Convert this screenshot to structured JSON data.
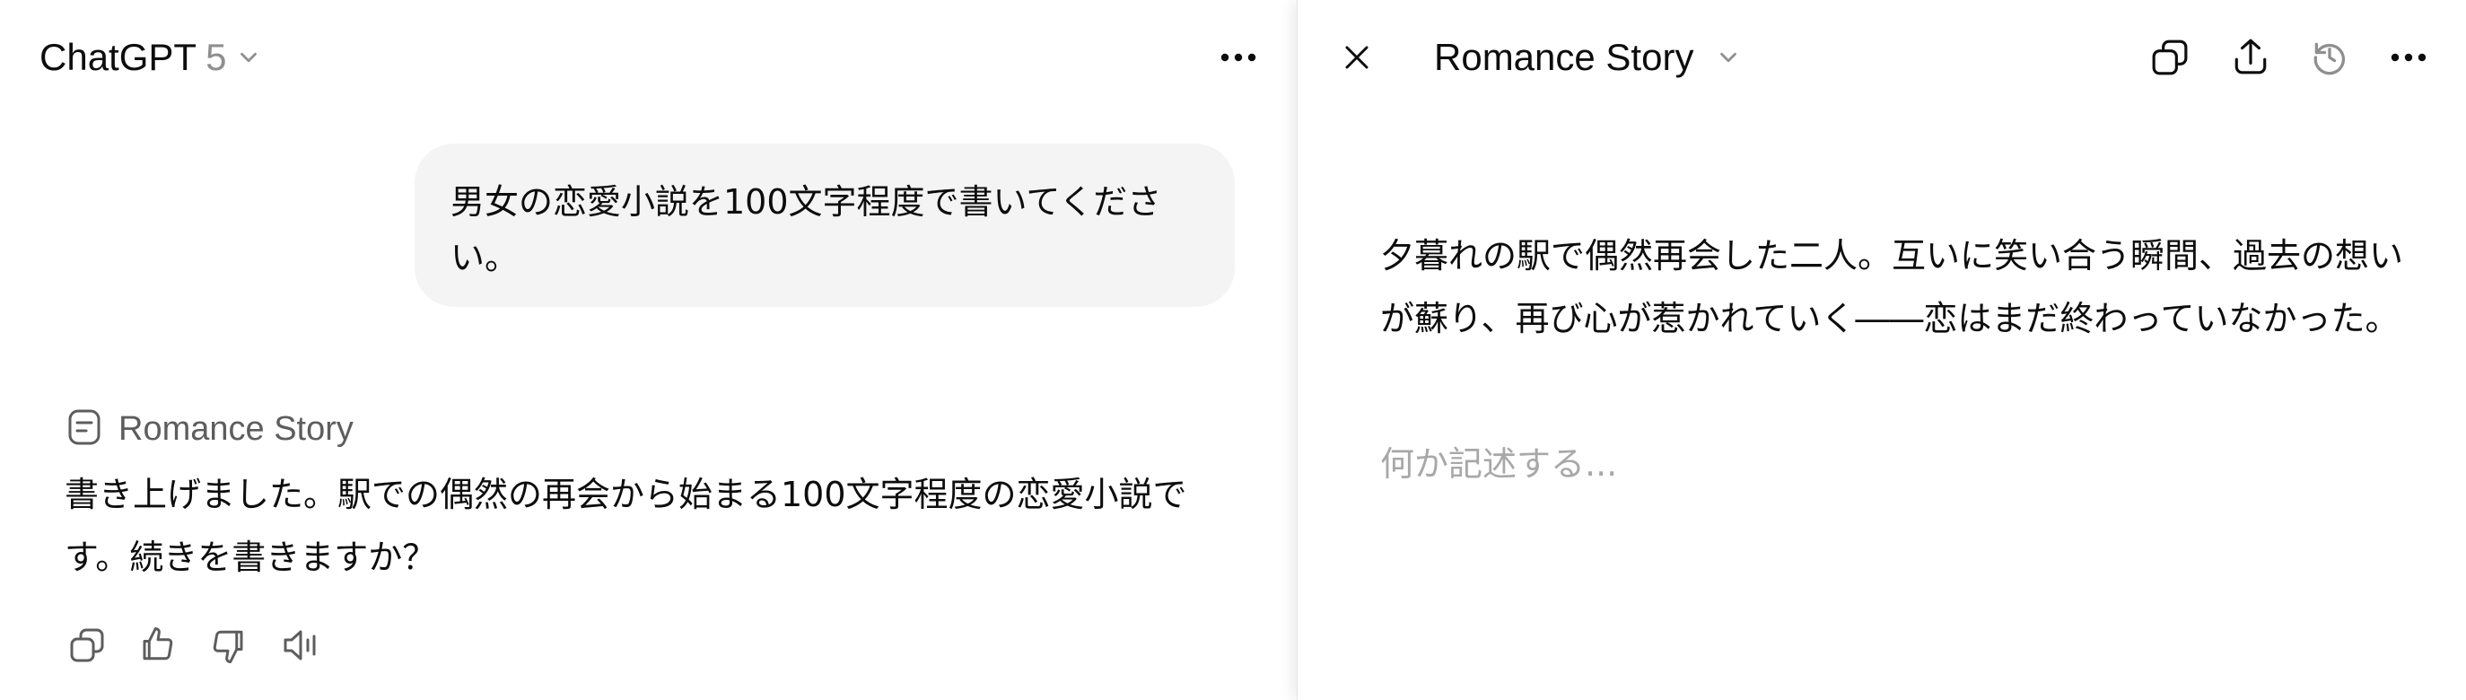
{
  "chat": {
    "model_name": "ChatGPT",
    "model_version": "5",
    "user_message": "男女の恋愛小説を100文字程度で書いてください。",
    "doc_chip_title": "Romance Story",
    "assistant_message": "書き上げました。駅での偶然の再会から始まる100文字程度の恋愛小説です。続きを書きますか？",
    "icons": {
      "model_dropdown": "chevron-down-icon",
      "more": "more-horizontal-icon",
      "doc": "document-icon",
      "copy": "copy-icon",
      "thumbs_up": "thumbs-up-icon",
      "thumbs_down": "thumbs-down-icon",
      "read_aloud": "speaker-icon"
    }
  },
  "canvas": {
    "title": "Romance Story",
    "content": "夕暮れの駅で偶然再会した二人。互いに笑い合う瞬間、過去の想いが蘇り、再び心が惹かれていく――恋はまだ終わっていなかった。",
    "placeholder": "何か記述する...",
    "icons": {
      "close": "close-icon",
      "title_dropdown": "chevron-down-icon",
      "copy": "copy-icon",
      "share": "share-icon",
      "history": "history-icon",
      "more": "more-horizontal-icon"
    }
  },
  "colors": {
    "text": "#0d0d0d",
    "muted": "#8f8f8f",
    "bubble": "#f4f4f4",
    "placeholder": "#a8a8a8"
  }
}
